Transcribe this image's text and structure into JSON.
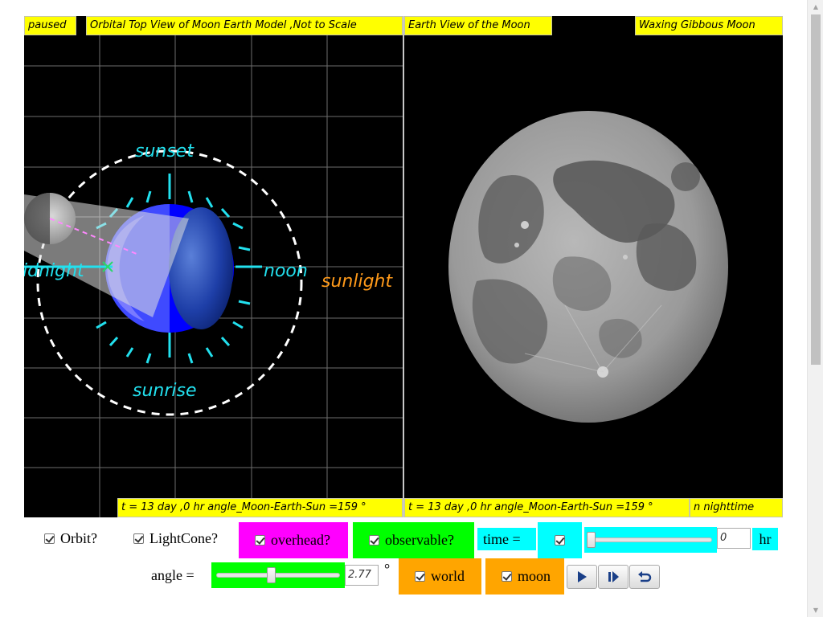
{
  "left_panel": {
    "status": "paused",
    "title": "Orbital Top View of Moon Earth Model ,Not to Scale",
    "bottom_label": "t = 13 day ,0 hr angle_Moon-Earth-Sun =159 °",
    "labels": {
      "sunset": "sunset",
      "sunrise": "sunrise",
      "midnight": "idnight",
      "noon": "noon",
      "sunlight": "sunlight"
    }
  },
  "right_panel": {
    "title": "Earth View of the Moon",
    "phase": "Waxing Gibbous Moon",
    "bottom_label": "t = 13 day ,0 hr angle_Moon-Earth-Sun =159 °",
    "bottom_right": "n nighttime"
  },
  "controls": {
    "orbit_label": "Orbit?",
    "orbit_checked": true,
    "lightcone_label": "LightCone?",
    "lightcone_checked": true,
    "overhead_label": "overhead?",
    "overhead_checked": true,
    "observable_label": "observable?",
    "observable_checked": true,
    "time_label": "time =",
    "time_checked": true,
    "time_value": "0",
    "time_slider_fraction": 0.0,
    "time_unit": "hr",
    "angle_label": "angle =",
    "angle_value": "2.77",
    "angle_slider_fraction": 0.44,
    "angle_unit": "°",
    "world_label": "world",
    "world_checked": true,
    "moon_label": "moon",
    "moon_checked": true
  },
  "icons": [
    "play-icon",
    "step-forward-icon",
    "reset-icon"
  ],
  "colors": {
    "label_bg": "#ffff00",
    "cyan_text": "#22e0ee",
    "orange_text": "#ff9a1a",
    "magenta_bg": "#ff00ff",
    "green_bg": "#00ff00",
    "cyan_bg": "#00ffff",
    "orange_bg": "#ffa500"
  }
}
